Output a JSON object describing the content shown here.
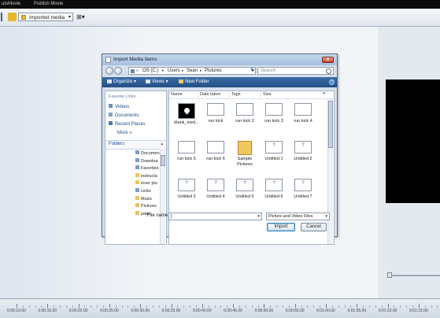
{
  "app": {
    "topbar_left": "utsMovie",
    "topbar_right": "Publish Movie",
    "collection_dropdown": "Imported media"
  },
  "dialog": {
    "title": "Import Media Items",
    "address": {
      "crumbs": [
        "OS (C:)",
        "Users",
        "Sean",
        "Pictures"
      ],
      "prefix": "«"
    },
    "search_placeholder": "Search",
    "cmd": {
      "organize": "Organize",
      "views": "Views",
      "new_folder": "New Folder"
    },
    "nav": {
      "favorites_header": "Favorite Links",
      "favorites": [
        "Videos",
        "Documents",
        "Recent Places"
      ],
      "more": "More »",
      "folders_label": "Folders",
      "tree": [
        "Documen",
        "Downloa",
        "Favorites",
        "instructa",
        "inver plu",
        "Links",
        "Music",
        "Pictures",
        "paint"
      ]
    },
    "columns": [
      "Name",
      "Date taken",
      "Tags",
      "Size"
    ],
    "columns_more": "»",
    "files": [
      {
        "name": "blank_med...",
        "kind": "black"
      },
      {
        "name": "run kick",
        "kind": "blank"
      },
      {
        "name": "run kick 2",
        "kind": "blank"
      },
      {
        "name": "run kick 3",
        "kind": "blank"
      },
      {
        "name": "run kick 4",
        "kind": "blank"
      },
      {
        "name": "run kick 5",
        "kind": "blank"
      },
      {
        "name": "run kick 6",
        "kind": "blank"
      },
      {
        "name": "Sample Pictures",
        "kind": "folder"
      },
      {
        "name": "Untitled 1",
        "kind": "ques"
      },
      {
        "name": "Untitled 2",
        "kind": "ques"
      },
      {
        "name": "Untitled 3",
        "kind": "ques"
      },
      {
        "name": "Untitled 4",
        "kind": "ques"
      },
      {
        "name": "Untitled 5",
        "kind": "ques"
      },
      {
        "name": "Untitled 6",
        "kind": "ques"
      },
      {
        "name": "Untitled 7",
        "kind": "ques"
      }
    ],
    "file_name_label": "File name:",
    "file_name_value": "|",
    "file_type": "Picture and Video Files",
    "import_label": "Import",
    "cancel_label": "Cancel"
  },
  "timeline": {
    "labels": [
      "0:00:10.00",
      "0:00:15.00",
      "0:00:20.00",
      "0:00:25.00",
      "0:00:30.00",
      "0:00:35.00",
      "0:00:40.00",
      "0:00:45.00",
      "0:00:50.00",
      "0:00:55.00",
      "0:01:00.00",
      "0:01:05.00",
      "0:01:10.00",
      "0:01:15.00"
    ]
  },
  "colors": {
    "accent": "#234f84",
    "preview": "#000000"
  }
}
